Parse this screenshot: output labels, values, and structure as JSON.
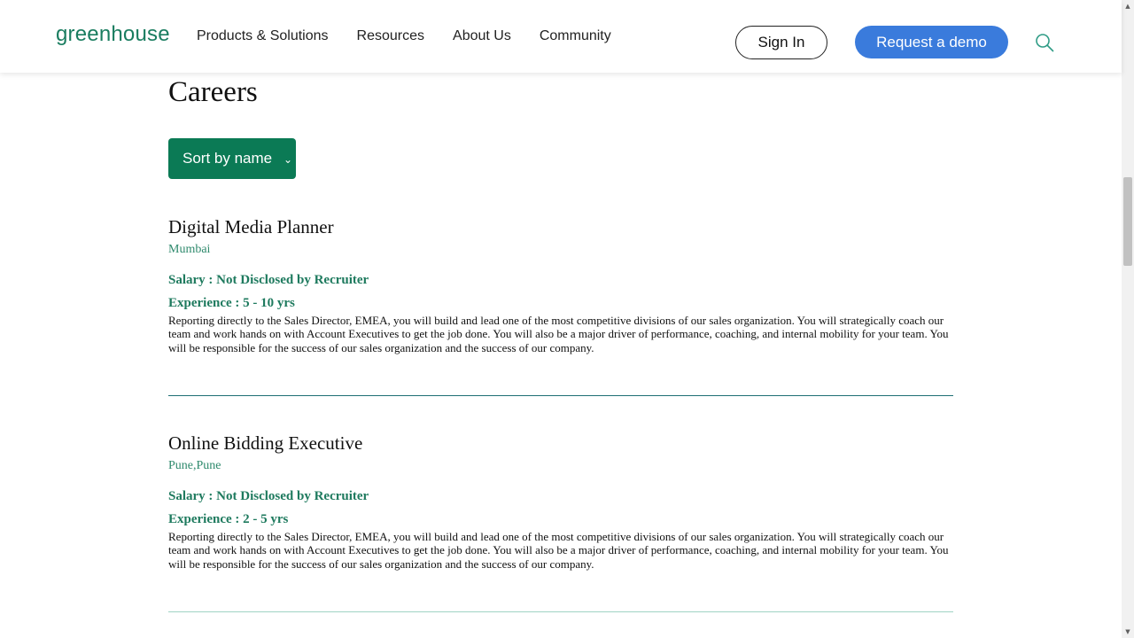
{
  "header": {
    "logo": "greenhouse",
    "nav": [
      {
        "label": "Products & Solutions"
      },
      {
        "label": "Resources"
      },
      {
        "label": "About Us"
      },
      {
        "label": "Community"
      }
    ],
    "sign_in": "Sign In",
    "request_demo": "Request a demo",
    "search_icon": "search-icon"
  },
  "page": {
    "title": "Careers",
    "sort_label": "Sort by name"
  },
  "jobs": [
    {
      "title": "Digital Media Planner",
      "location": "Mumbai",
      "salary": "Salary : Not Disclosed by Recruiter",
      "experience": "Experience : 5 - 10 yrs",
      "description": "Reporting directly to the Sales Director, EMEA, you will build and lead one of the most competitive divisions of our sales organization. You will strategically coach our team and work hands on with Account Executives to get the job done. You will also be a major driver of performance, coaching, and internal mobility for your team. You will be responsible for the success of our sales organization and the success of our company."
    },
    {
      "title": "Online Bidding Executive",
      "location": "Pune,Pune",
      "salary": "Salary : Not Disclosed by Recruiter",
      "experience": "Experience : 2 - 5 yrs",
      "description": "Reporting directly to the Sales Director, EMEA, you will build and lead one of the most competitive divisions of our sales organization. You will strategically coach our team and work hands on with Account Executives to get the job done. You will also be a major driver of performance, coaching, and internal mobility for your team. You will be responsible for the success of our sales organization and the success of our company."
    }
  ],
  "colors": {
    "brand_green": "#0b7a55",
    "demo_blue": "#3a7bdc",
    "accent_text_green": "#1e7a5e"
  }
}
